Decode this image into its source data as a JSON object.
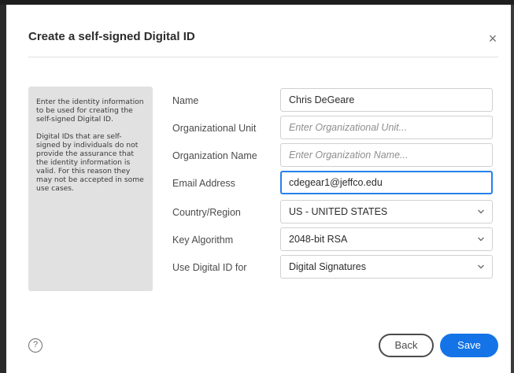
{
  "dialog": {
    "title": "Create a self-signed Digital ID",
    "close_symbol": "×"
  },
  "info": {
    "paragraph1": "Enter the identity information to be used for creating the self-signed Digital ID.",
    "paragraph2": "Digital IDs that are self-signed by individuals do not provide the assurance that the identity information is valid. For this reason they may not be accepted in some use cases."
  },
  "form": {
    "name": {
      "label": "Name",
      "value": "Chris DeGeare",
      "placeholder": ""
    },
    "org_unit": {
      "label": "Organizational Unit",
      "value": "",
      "placeholder": "Enter Organizational Unit..."
    },
    "org_name": {
      "label": "Organization Name",
      "value": "",
      "placeholder": "Enter Organization Name..."
    },
    "email": {
      "label": "Email Address",
      "value": "cdegear1@jeffco.edu",
      "placeholder": ""
    },
    "country": {
      "label": "Country/Region",
      "value": "US - UNITED STATES"
    },
    "key_algorithm": {
      "label": "Key Algorithm",
      "value": "2048-bit RSA"
    },
    "use_for": {
      "label": "Use Digital ID for",
      "value": "Digital Signatures"
    }
  },
  "footer": {
    "help_symbol": "?",
    "back_label": "Back",
    "save_label": "Save"
  },
  "icons": {
    "close": "close-icon",
    "help": "help-icon",
    "dropdown": "chevron-down-icon"
  },
  "colors": {
    "accent": "#1473e6",
    "focus_border": "#2680eb",
    "info_panel_bg": "#e1e1e1"
  }
}
